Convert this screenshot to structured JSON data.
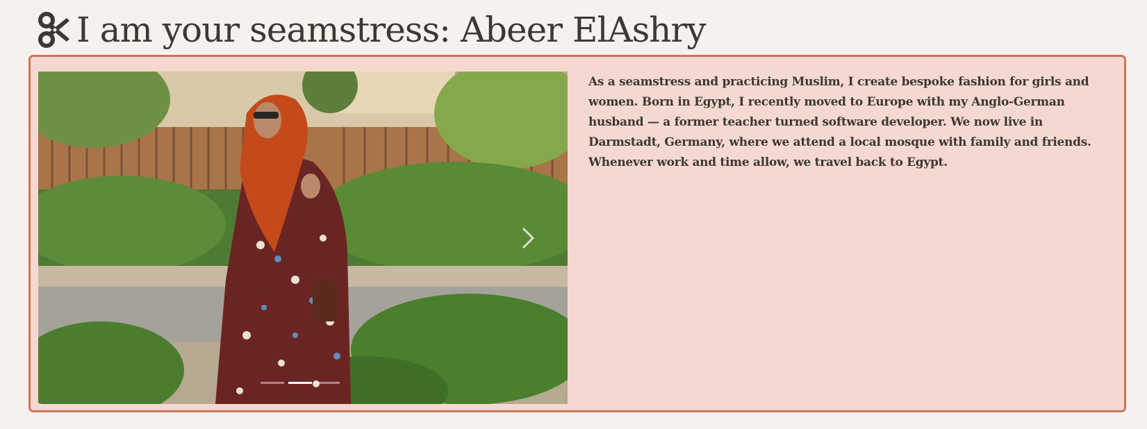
{
  "header": {
    "icon": "scissors-icon",
    "title": "I am your seamstress: Abeer ElAshry"
  },
  "carousel": {
    "image": "Woman in orange headscarf and floral dress standing in a garden",
    "next_icon": "chevron-right-icon",
    "slide_count": 3,
    "active_slide": 2
  },
  "bio": {
    "text": "As a seamstress and practicing Muslim, I create bespoke fashion for girls and women. Born in Egypt, I recently moved to Europe with my Anglo-German husband — a former teacher turned software developer. We now live in Darmstadt, Germany, where we attend a local mosque with family and friends. Whenever work and time allow, we travel back to Egypt."
  },
  "colors": {
    "page_background": "#f5f1ec",
    "card_background": "#f5d9d0",
    "card_border": "#c7765d",
    "text": "#3d3833"
  }
}
